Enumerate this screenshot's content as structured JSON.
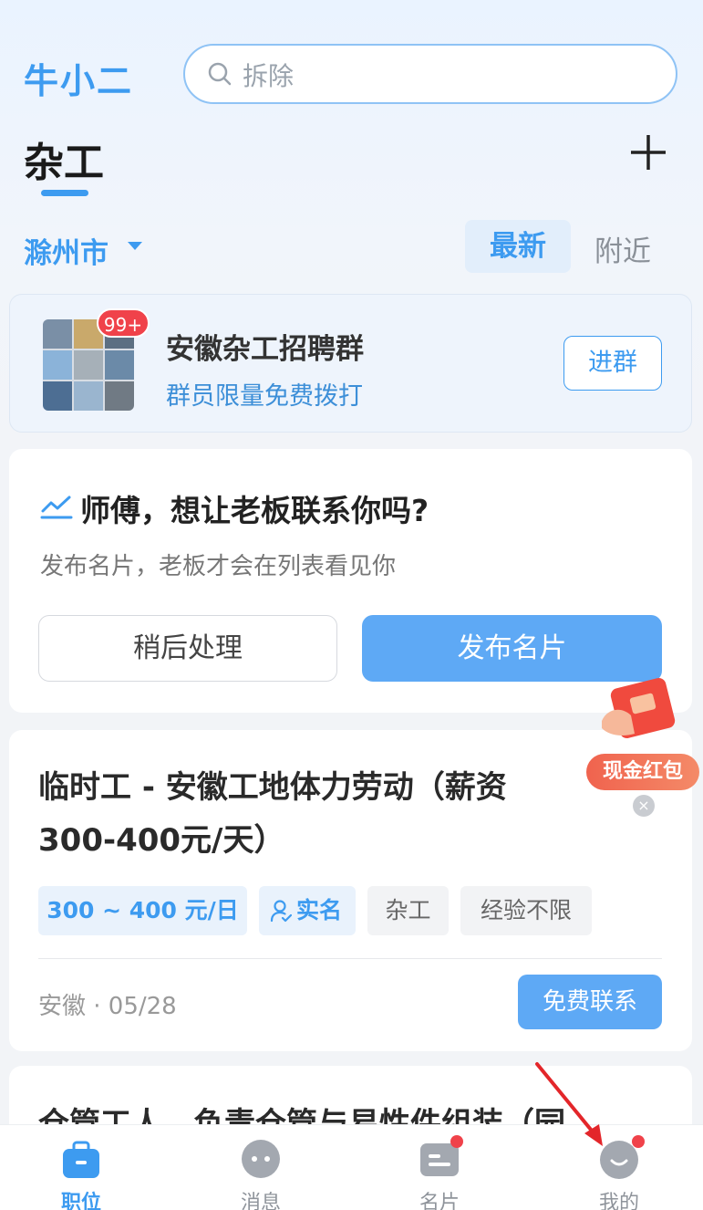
{
  "header": {
    "logo": "牛小二",
    "search_placeholder": "拆除",
    "title": "杂工"
  },
  "filters": {
    "city": "滁州市",
    "tab_latest": "最新",
    "tab_nearby": "附近"
  },
  "group": {
    "badge": "99+",
    "name": "安徽杂工招聘群",
    "subtitle": "群员限量免费拨打",
    "join_label": "进群"
  },
  "promo": {
    "title": "师傅，想让老板联系你吗?",
    "subtitle": "发布名片，老板才会在列表看见你",
    "later_label": "稍后处理",
    "publish_label": "发布名片"
  },
  "float_ad": {
    "label": "现金红包",
    "close": "×"
  },
  "job": {
    "title": "临时工 - 安徽工地体力劳动（薪资300-400元/天）",
    "tags": [
      "300 ~ 400 元/日",
      "实名",
      "杂工",
      "经验不限"
    ],
    "meta": "安徽 · 05/28",
    "contact_label": "免费联系"
  },
  "next_job": {
    "title": "仓管工人，负责仓管与易性件组装（园"
  },
  "nav": {
    "items": [
      {
        "label": "职位",
        "icon": "briefcase-icon",
        "active": true
      },
      {
        "label": "消息",
        "icon": "chat-bubble-icon",
        "active": false
      },
      {
        "label": "名片",
        "icon": "card-icon",
        "active": false
      },
      {
        "label": "我的",
        "icon": "profile-icon",
        "active": false
      }
    ]
  },
  "colors": {
    "accent": "#3d9bf0",
    "button_blue": "#5ea9f5",
    "badge_red": "#f0424a"
  }
}
